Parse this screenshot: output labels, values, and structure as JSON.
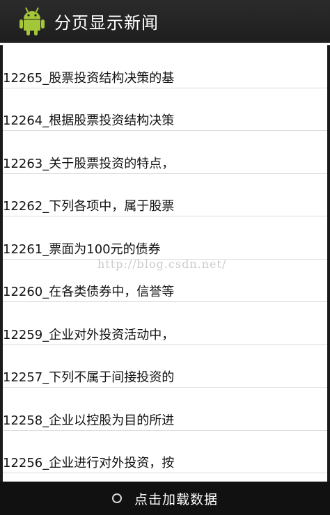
{
  "header": {
    "title": "分页显示新闻",
    "icon": "android-robot-icon",
    "icon_color": "#a4c639",
    "background": "#222222"
  },
  "news_list": {
    "items": [
      {
        "label": "12265_股票投资结构决策的基"
      },
      {
        "label": "12264_根据股票投资结构决策"
      },
      {
        "label": "12263_关于股票投资的特点，"
      },
      {
        "label": "12262_下列各项中，属于股票"
      },
      {
        "label": "12261_票面为100元的债券"
      },
      {
        "label": "12260_在各类债券中，信誉等"
      },
      {
        "label": "12259_企业对外投资活动中，"
      },
      {
        "label": "12257_下列不属于间接投资的"
      },
      {
        "label": "12258_企业以控股为目的所进"
      },
      {
        "label": "12256_企业进行对外投资，按"
      }
    ]
  },
  "watermark": {
    "text": "http://blog.csdn.net/"
  },
  "footer": {
    "label": "点击加载数据",
    "icon": "loading-spinner-icon"
  }
}
